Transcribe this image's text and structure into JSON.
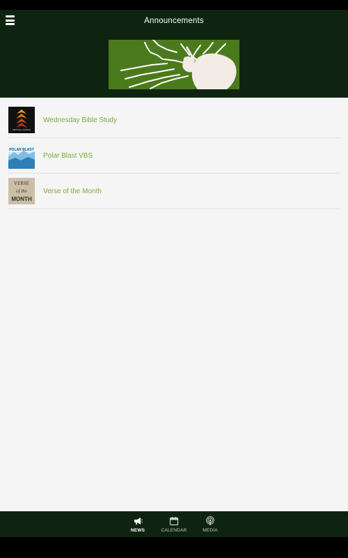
{
  "header": {
    "title": "Announcements",
    "menu_icon": "hamburger-menu-icon"
  },
  "banner": {
    "logo_icon": "locust-logo",
    "logo_bg_color": "#4b7a1c"
  },
  "announcements": [
    {
      "title": "Wednesday Bible Study",
      "thumb": "chevron-church-logo",
      "thumb_text": "VERTICAL CHURCH"
    },
    {
      "title": "Polar Blast VBS",
      "thumb": "polar-blast-graphic",
      "thumb_text": "POLAR BLAST"
    },
    {
      "title": "Verse of the Month",
      "thumb": "verse-of-the-month-graphic",
      "thumb_text_lines": [
        "VERSE",
        "of the",
        "MONTH"
      ]
    }
  ],
  "bottom_nav": {
    "items": [
      {
        "label": "NEWS",
        "icon": "megaphone-icon",
        "active": true
      },
      {
        "label": "CALENDAR",
        "icon": "calendar-icon",
        "active": false
      },
      {
        "label": "MEDIA",
        "icon": "podcast-icon",
        "active": false
      }
    ]
  },
  "colors": {
    "header_bg": "#0f2410",
    "accent_text": "#7aaa3a",
    "content_bg": "#f5f5f5"
  }
}
